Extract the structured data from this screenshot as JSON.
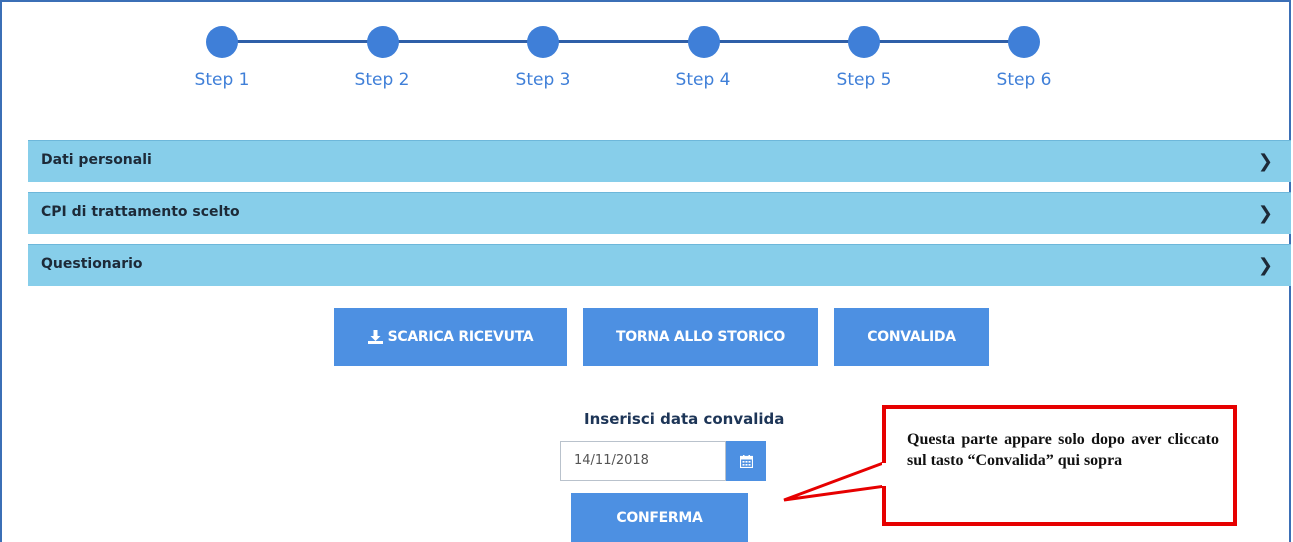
{
  "stepper": {
    "steps": [
      {
        "label": "Step 1"
      },
      {
        "label": "Step 2"
      },
      {
        "label": "Step 3"
      },
      {
        "label": "Step 4"
      },
      {
        "label": "Step 5"
      },
      {
        "label": "Step 6"
      }
    ],
    "color": "#3f7fd8"
  },
  "accordion": {
    "sections": [
      {
        "label": "Dati personali"
      },
      {
        "label": "CPI di trattamento scelto"
      },
      {
        "label": "Questionario"
      }
    ],
    "color": "#87ceea"
  },
  "actions": {
    "download_label": "SCARICA RICEVUTA",
    "back_label": "TORNA ALLO STORICO",
    "validate_label": "CONVALIDA",
    "color": "#4d90e2"
  },
  "validation": {
    "title": "Inserisci data convalida",
    "date_value": "14/11/2018",
    "confirm_label": "CONFERMA"
  },
  "annotation": {
    "text": "Questa parte appare solo dopo aver cliccato sul tasto “Convalida” qui sopra",
    "border_color": "#e60000"
  },
  "icons": {
    "download": "download-icon",
    "calendar": "calendar-icon",
    "chevron": "chevron-right-icon"
  }
}
